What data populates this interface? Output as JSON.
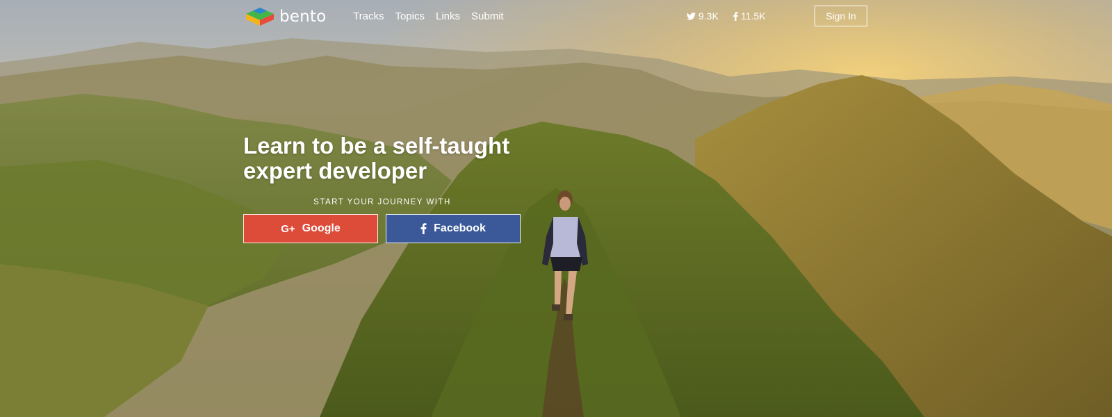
{
  "brand": {
    "name": "bento"
  },
  "nav": {
    "items": [
      "Tracks",
      "Topics",
      "Links",
      "Submit"
    ]
  },
  "social": {
    "twitter_count": "9.3K",
    "facebook_count": "11.5K"
  },
  "header": {
    "signin_label": "Sign In"
  },
  "hero": {
    "title": "Learn to be a self-taught expert developer",
    "subtitle": "START YOUR JOURNEY WITH",
    "google_label": "Google",
    "facebook_label": "Facebook"
  },
  "colors": {
    "google": "#dd4b39",
    "facebook": "#3b5998",
    "logo_green": "#43b649",
    "logo_blue": "#2b87d1",
    "logo_red": "#e84b3c",
    "logo_yellow": "#f5b41b"
  },
  "icons": [
    "bento-logo-icon",
    "twitter-icon",
    "facebook-icon",
    "google-plus-icon",
    "facebook-f-icon"
  ]
}
